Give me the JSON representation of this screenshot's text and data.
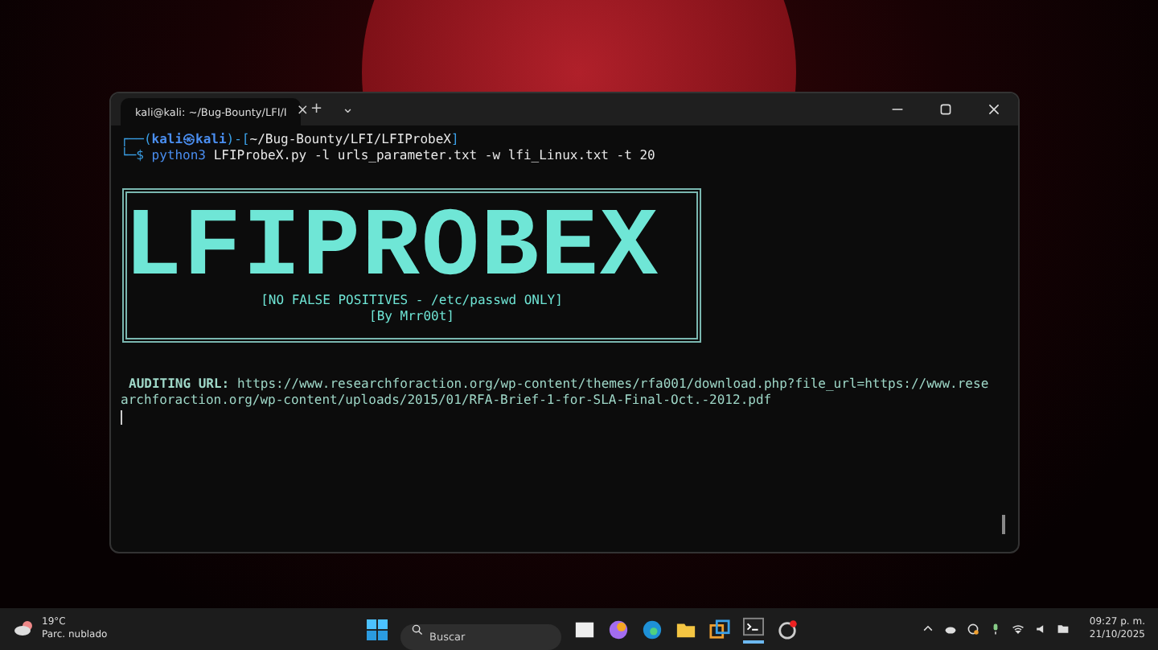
{
  "window": {
    "tab_title": "kali@kali: ~/Bug-Bounty/LFI/I",
    "tab_close": "×",
    "new_tab": "+",
    "tab_menu": "⌄"
  },
  "terminal": {
    "prompt": {
      "prefix": "┌──(",
      "user": "kali㉿kali",
      "mid": ")-[",
      "path": "~/Bug-Bounty/LFI/LFIProbeX",
      "suffix": "]"
    },
    "command_line": {
      "prefix": "└─$",
      "program": "python3",
      "args": "LFIProbeX.py -l urls_parameter.txt -w lfi_Linux.txt -t 20"
    },
    "banner": {
      "title": "LFIPROBEX",
      "subtitle": "[NO FALSE POSITIVES - /etc/passwd ONLY]",
      "author": "[By Mrr00t]"
    },
    "audit": {
      "line": "**AUDITING URL:** https://www.researchforaction.org/wp-content/themes/rfa001/download.php?file_url=https://www.researchforaction.org/wp-content/uploads/2015/01/RFA-Brief-1-for-SLA-Final-Oct.-2012.pdf"
    }
  },
  "taskbar": {
    "temperature": "19°C",
    "weather": "Parc. nublado",
    "search_placeholder": "Buscar",
    "time": "09:27 p. m.",
    "date": "21/10/2025"
  }
}
